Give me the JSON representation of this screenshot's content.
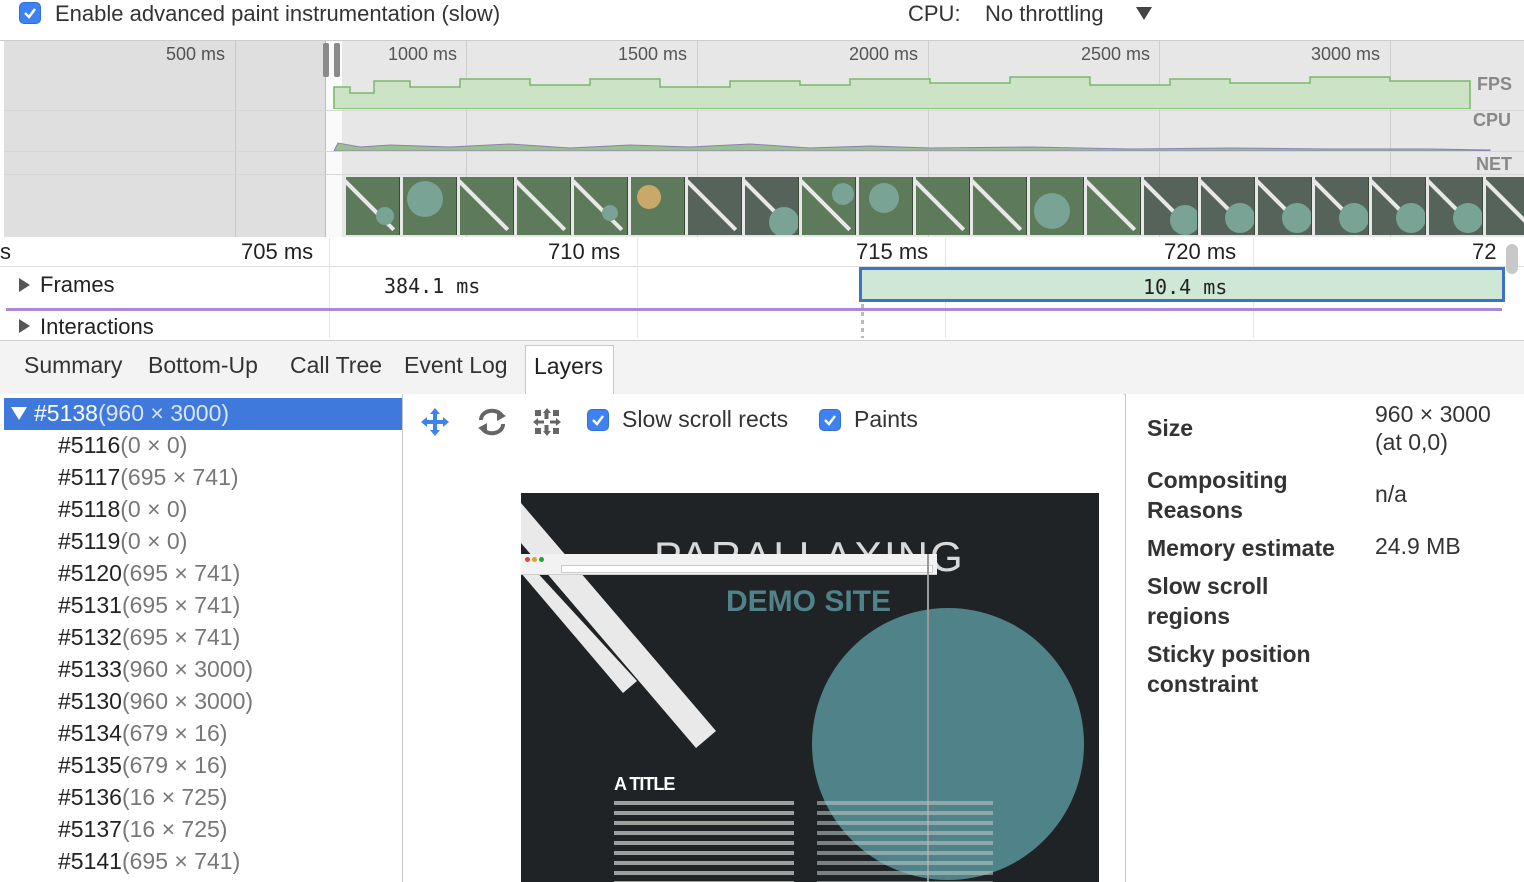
{
  "toolbar": {
    "paint_instrumentation_label": "Enable advanced paint instrumentation (slow)",
    "paint_instrumentation_checked": true,
    "cpu_label": "CPU:",
    "cpu_throttling": "No throttling"
  },
  "overview": {
    "ticks": [
      "500 ms",
      "1000 ms",
      "1500 ms",
      "2000 ms",
      "2500 ms",
      "3000 ms"
    ],
    "tracks": [
      "FPS",
      "CPU",
      "NET"
    ]
  },
  "flamechart": {
    "ruler_ticks": [
      "s",
      "705 ms",
      "710 ms",
      "715 ms",
      "720 ms",
      "72"
    ],
    "frames_label": "Frames",
    "frame_durations": [
      "384.1 ms",
      "10.4 ms"
    ],
    "interactions_label": "Interactions"
  },
  "tabs": [
    "Summary",
    "Bottom-Up",
    "Call Tree",
    "Event Log",
    "Layers"
  ],
  "active_tab": "Layers",
  "layer_tree": {
    "root": {
      "id": "#5138",
      "size": "(960 × 3000)"
    },
    "children": [
      {
        "id": "#5116",
        "size": "(0 × 0)"
      },
      {
        "id": "#5117",
        "size": "(695 × 741)"
      },
      {
        "id": "#5118",
        "size": "(0 × 0)"
      },
      {
        "id": "#5119",
        "size": "(0 × 0)"
      },
      {
        "id": "#5120",
        "size": "(695 × 741)"
      },
      {
        "id": "#5131",
        "size": "(695 × 741)"
      },
      {
        "id": "#5132",
        "size": "(695 × 741)"
      },
      {
        "id": "#5133",
        "size": "(960 × 3000)"
      },
      {
        "id": "#5130",
        "size": "(960 × 3000)"
      },
      {
        "id": "#5134",
        "size": "(679 × 16)"
      },
      {
        "id": "#5135",
        "size": "(679 × 16)"
      },
      {
        "id": "#5136",
        "size": "(16 × 725)"
      },
      {
        "id": "#5137",
        "size": "(16 × 725)"
      },
      {
        "id": "#5141",
        "size": "(695 × 741)"
      }
    ]
  },
  "layer_viewer": {
    "slow_scroll_rects_label": "Slow scroll rects",
    "slow_scroll_rects_checked": true,
    "paints_label": "Paints",
    "paints_checked": true,
    "tools": [
      "pan-icon",
      "rotate-icon",
      "reset-transform-icon"
    ],
    "preview": {
      "site_title": "PARALLAXING",
      "site_subtitle": "DEMO SITE",
      "section_title": "A TITLE"
    }
  },
  "details": {
    "size_label": "Size",
    "size_value": "960 × 3000",
    "size_position": "(at 0,0)",
    "compositing_label_1": "Compositing",
    "compositing_label_2": "Reasons",
    "compositing_value": "n/a",
    "memory_label": "Memory estimate",
    "memory_value": "24.9 MB",
    "slow_scroll_label_1": "Slow scroll",
    "slow_scroll_label_2": "regions",
    "sticky_label_1": "Sticky position",
    "sticky_label_2": "constraint"
  },
  "colors": {
    "accent": "#3d82f0",
    "selected_row": "#3e79db",
    "frame_fill": "#cfe8d5",
    "fps_fill": "#cde3c6",
    "interactions_line": "#a98ad8",
    "preview_bg": "#1f2325",
    "preview_circle": "#4f8389"
  }
}
